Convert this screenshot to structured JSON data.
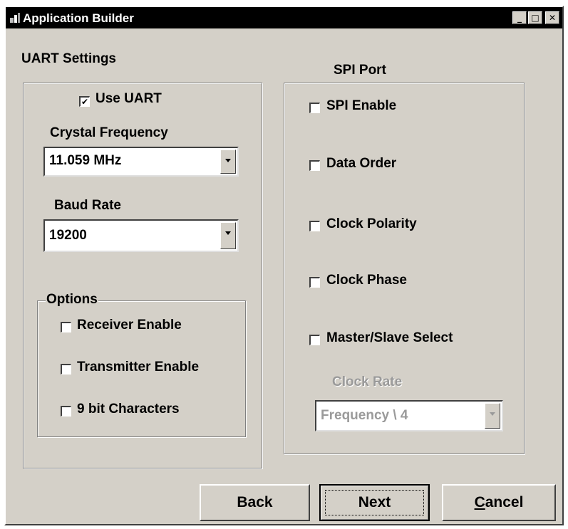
{
  "window": {
    "title": "Application Builder",
    "icon": "app-builder-icon",
    "controls": {
      "minimize": "_",
      "maximize": "□",
      "close": "✕"
    }
  },
  "uart": {
    "title": "UART Settings",
    "use_uart": {
      "label": "Use UART",
      "checked": true
    },
    "crystal_frequency": {
      "label": "Crystal Frequency",
      "value": "11.059 MHz"
    },
    "baud_rate": {
      "label": "Baud Rate",
      "value": "19200"
    },
    "options": {
      "title": "Options",
      "items": [
        {
          "label": "Receiver Enable",
          "checked": false
        },
        {
          "label": "Transmitter Enable",
          "checked": false
        },
        {
          "label": "9 bit Characters",
          "checked": false
        }
      ]
    }
  },
  "spi": {
    "title": "SPI Port",
    "items": [
      {
        "label": "SPI Enable",
        "checked": false
      },
      {
        "label": "Data Order",
        "checked": false
      },
      {
        "label": "Clock Polarity",
        "checked": false
      },
      {
        "label": "Clock Phase",
        "checked": false
      },
      {
        "label": "Master/Slave Select",
        "checked": false
      }
    ],
    "clock_rate": {
      "label": "Clock Rate",
      "value": "Frequency \\ 4",
      "enabled": false
    }
  },
  "buttons": {
    "back": "Back",
    "next": "Next",
    "cancel_prefix": "C",
    "cancel_rest": "ancel"
  }
}
